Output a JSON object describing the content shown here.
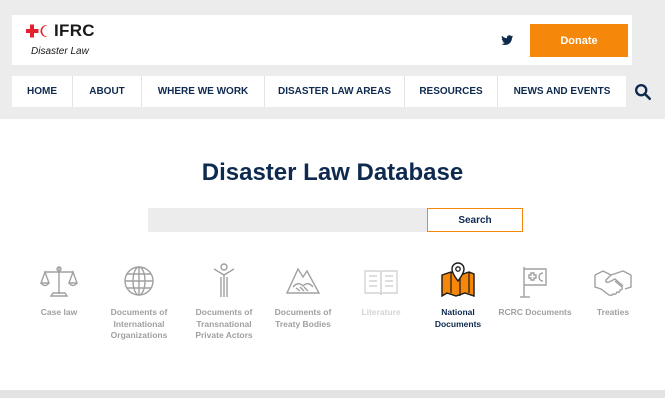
{
  "header": {
    "logo_text": "IFRC",
    "logo_subtitle": "Disaster Law",
    "donate_label": "Donate"
  },
  "nav": {
    "items": [
      {
        "label": "HOME"
      },
      {
        "label": "ABOUT"
      },
      {
        "label": "WHERE WE WORK"
      },
      {
        "label": "DISASTER LAW AREAS"
      },
      {
        "label": "RESOURCES"
      },
      {
        "label": "NEWS AND EVENTS"
      }
    ]
  },
  "main": {
    "title": "Disaster Law Database",
    "search": {
      "value": "",
      "placeholder": "",
      "button_label": "Search"
    },
    "categories": [
      {
        "label": "Case law",
        "icon": "scales-icon",
        "state": "default"
      },
      {
        "label": "Documents of International Organizations",
        "icon": "globe-icon",
        "state": "default"
      },
      {
        "label": "Documents of Transnational Private Actors",
        "icon": "person-icon",
        "state": "default"
      },
      {
        "label": "Documents of Treaty Bodies",
        "icon": "handshake-mountain-icon",
        "state": "default"
      },
      {
        "label": "Literature",
        "icon": "book-icon",
        "state": "disabled"
      },
      {
        "label": "National Documents",
        "icon": "map-pin-icon",
        "state": "active"
      },
      {
        "label": "RCRC Documents",
        "icon": "red-cross-flag-icon",
        "state": "default"
      },
      {
        "label": "Treaties",
        "icon": "handshake-icon",
        "state": "default"
      }
    ]
  },
  "colors": {
    "brand_red": "#e4202e",
    "accent_orange": "#f5870b",
    "navy": "#0f2a4f",
    "icon_gray": "#a0a0a0"
  }
}
